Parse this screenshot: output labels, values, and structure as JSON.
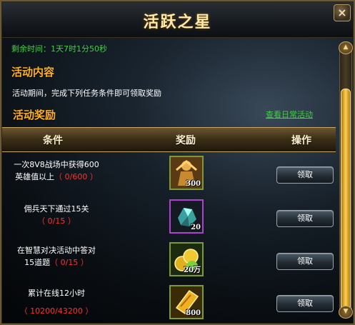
{
  "window": {
    "title": "活跃之星",
    "close_symbol": "×"
  },
  "remaining": "剩余时间：1天7时1分50秒",
  "sections": {
    "content_heading": "活动内容",
    "description": "活动期间，完成下列任务条件即可领取奖励",
    "reward_heading": "活动奖励",
    "view_daily_link": "查看日常活动"
  },
  "table": {
    "headers": [
      "条件",
      "奖励",
      "操作"
    ],
    "rows": [
      {
        "cond_line1": "一次8V8战场中获得600",
        "cond_line2": "英雄值以上",
        "progress": "（ 0/600 ）",
        "reward_qty": "300",
        "reward_icon": "hero-figure-icon",
        "button": "领取"
      },
      {
        "cond_line1": "佣兵天下通过15关",
        "cond_line2": "",
        "progress": "（ 0/15 ）",
        "reward_qty": "20",
        "reward_icon": "crystal-ore-icon",
        "button": "领取"
      },
      {
        "cond_line1": "在智慧对决活动中答对",
        "cond_line2": "15道题",
        "progress": "（ 0/15 ）",
        "reward_qty": "20万",
        "reward_icon": "gold-coins-icon",
        "button": "领取"
      },
      {
        "cond_line1": "累计在线12小时",
        "cond_line2": "",
        "progress": "（ 10200/43200 ）",
        "reward_qty": "800",
        "reward_icon": "gold-ticket-icon",
        "button": "领取"
      }
    ]
  },
  "colors": {
    "title": "#ffe8a8",
    "heading": "#ffb020",
    "green_text": "#40d040",
    "progress_red": "#ff3030",
    "frame_gold": "#c8a868"
  }
}
